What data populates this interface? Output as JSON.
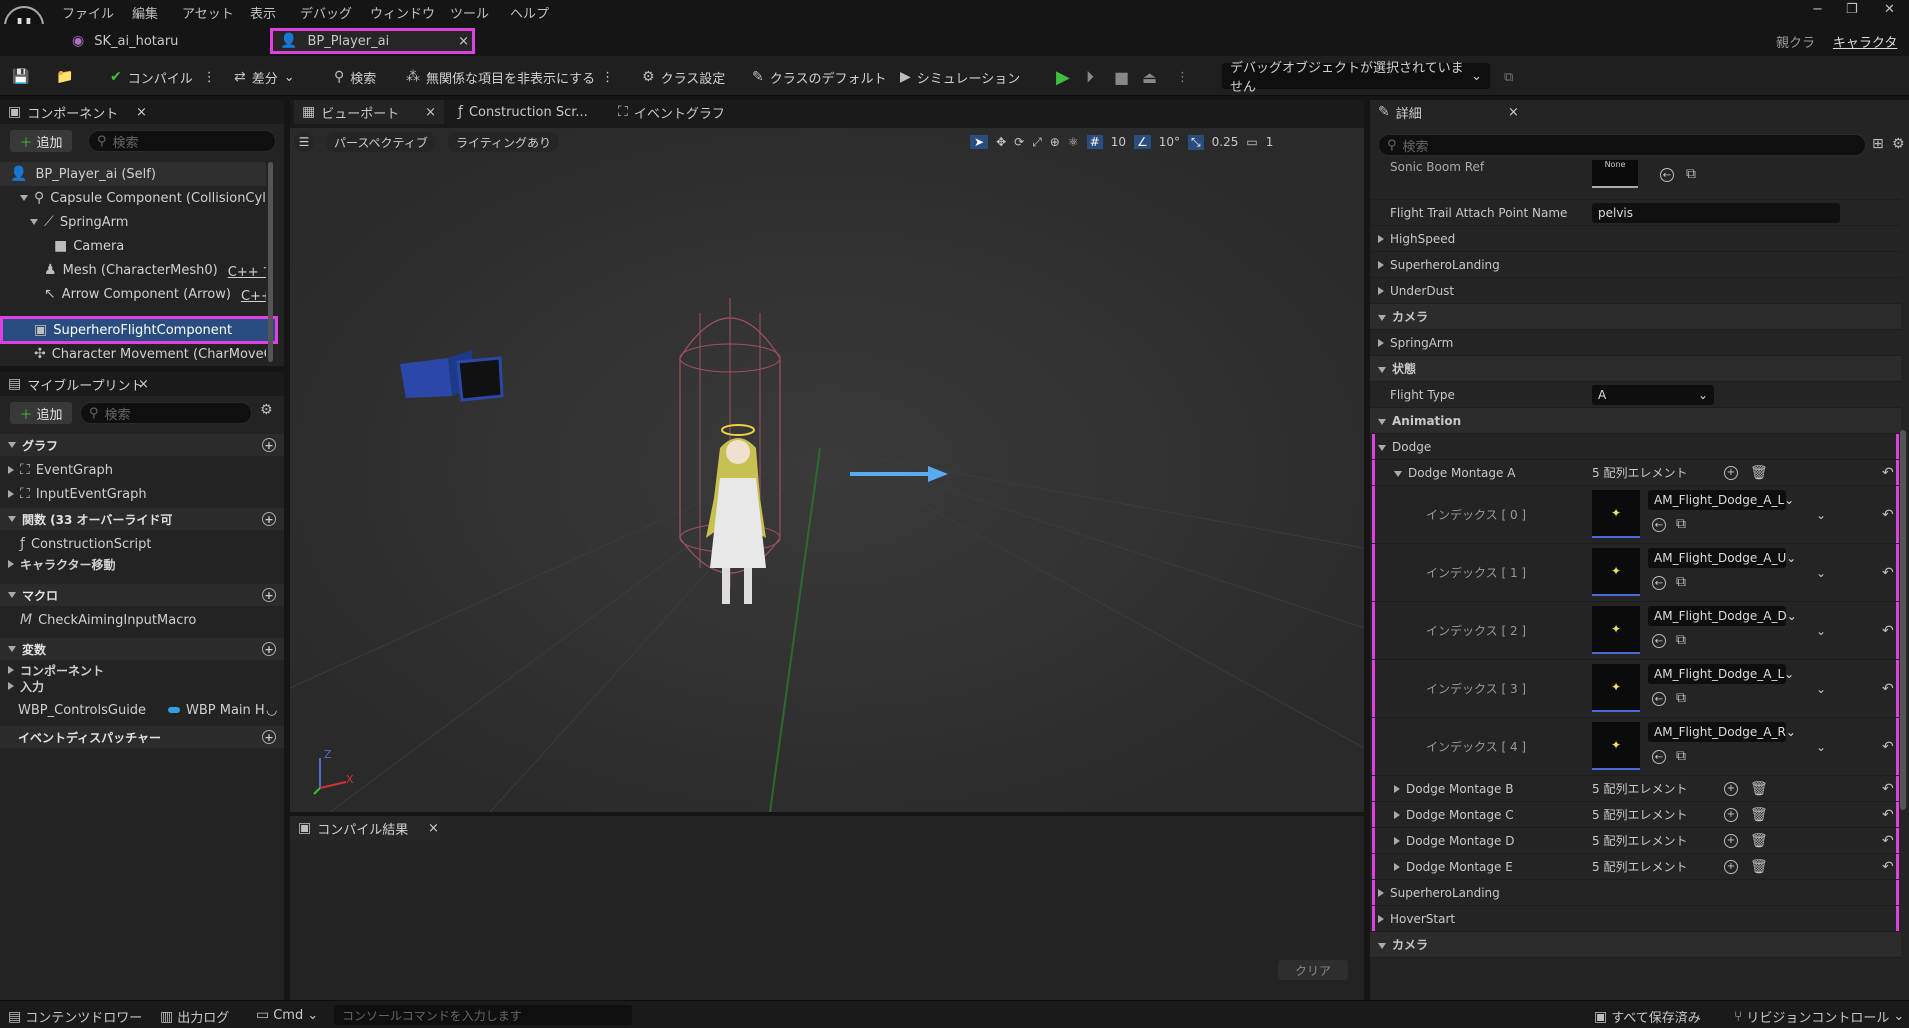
{
  "menu": [
    "ファイル",
    "編集",
    "アセット",
    "表示",
    "デバッグ",
    "ウィンドウ",
    "ツール",
    "ヘルプ"
  ],
  "window_controls": {
    "minimize": "−",
    "restore": "❐",
    "close": "✕"
  },
  "doc_tabs": [
    {
      "label": "SK_ai_hotaru"
    },
    {
      "label": "BP_Player_ai",
      "close": "×"
    }
  ],
  "parent_class": {
    "label": "親クラス",
    "value": "キャラクター"
  },
  "toolbar": {
    "compile": "コンパイル",
    "diff": "差分",
    "search": "検索",
    "hide_unrelated": "無関係な項目を非表示にする",
    "class_settings": "クラス設定",
    "class_defaults": "クラスのデフォルト",
    "simulation": "シミュレーション",
    "debug_object": "デバッグオブジェクトが選択されていません"
  },
  "components_panel": {
    "title": "コンポーネント",
    "add": "追加",
    "search_placeholder": "検索",
    "items": [
      "BP_Player_ai (Self)",
      "Capsule Component (CollisionCylinde",
      "SpringArm",
      "Camera",
      "Mesh (CharacterMesh0)",
      "Arrow Component (Arrow)",
      "SuperheroFlightComponent",
      "Character Movement (CharMoveCon"
    ],
    "cpp_edit": "C++ で編",
    "cpp_edit2": "C++ で"
  },
  "myblueprint": {
    "title": "マイブループリント",
    "add": "追加",
    "search_placeholder": "検索",
    "graph": "グラフ",
    "event_graph": "EventGraph",
    "input_event_graph": "InputEventGraph",
    "functions": "関数 (33 オーバーライド可",
    "construction_script": "ConstructionScript",
    "char_move": "キャラクター移動",
    "macros": "マクロ",
    "check_aiming": "CheckAimingInputMacro",
    "variables": "変数",
    "components": "コンポーネント",
    "input": "入力",
    "wbp_controls": "WBP_ControlsGuide",
    "wbp_main": "WBP Main H",
    "event_dispatchers": "イベントディスパッチャー"
  },
  "editor_tabs": {
    "viewport": "ビューポート",
    "construction": "Construction Scr...",
    "event_graph": "イベントグラフ"
  },
  "viewport": {
    "perspective": "パースペクティブ",
    "lighting": "ライティングあり",
    "grid": "10",
    "angle": "10°",
    "scale": "0.25",
    "camera": "1",
    "axis_x": "X",
    "axis_z": "Z"
  },
  "compile_results": {
    "title": "コンパイル結果",
    "clear": "クリア"
  },
  "details": {
    "title": "詳細",
    "search_placeholder": "検索",
    "sonic_boom": "Sonic Boom Ref",
    "sonic_boom_val": "None",
    "flight_trail": "Flight Trail Attach Point Name",
    "flight_trail_val": "pelvis",
    "high_speed": "HighSpeed",
    "superhero_landing": "SuperheroLanding",
    "under_dust": "UnderDust",
    "camera": "カメラ",
    "spring_arm": "SpringArm",
    "state": "状態",
    "flight_type": "Flight Type",
    "flight_type_val": "A",
    "animation": "Animation",
    "dodge": "Dodge",
    "dodge_a": "Dodge Montage A",
    "elements": "5 配列エレメント",
    "indices": [
      {
        "label": "インデックス [ 0 ]",
        "asset": "AM_Flight_Dodge_A_L"
      },
      {
        "label": "インデックス [ 1 ]",
        "asset": "AM_Flight_Dodge_A_U"
      },
      {
        "label": "インデックス [ 2 ]",
        "asset": "AM_Flight_Dodge_A_D"
      },
      {
        "label": "インデックス [ 3 ]",
        "asset": "AM_Flight_Dodge_A_L"
      },
      {
        "label": "インデックス [ 4 ]",
        "asset": "AM_Flight_Dodge_A_R"
      }
    ],
    "dodge_b": "Dodge Montage B",
    "dodge_c": "Dodge Montage C",
    "dodge_d": "Dodge Montage D",
    "dodge_e": "Dodge Montage E",
    "superhero_landing2": "SuperheroLanding",
    "hover_start": "HoverStart",
    "camera2": "カメラ"
  },
  "statusbar": {
    "content_drawer": "コンテンツドロワー",
    "output_log": "出力ログ",
    "cmd": "Cmd",
    "console_placeholder": "コンソールコマンドを入力します",
    "save_all": "すべて保存済み",
    "revision": "リビジョンコントロール"
  },
  "colors": {
    "highlight": "#e040e0",
    "accent_blue": "#4a6bd8",
    "play_green": "#3fbf3f"
  }
}
